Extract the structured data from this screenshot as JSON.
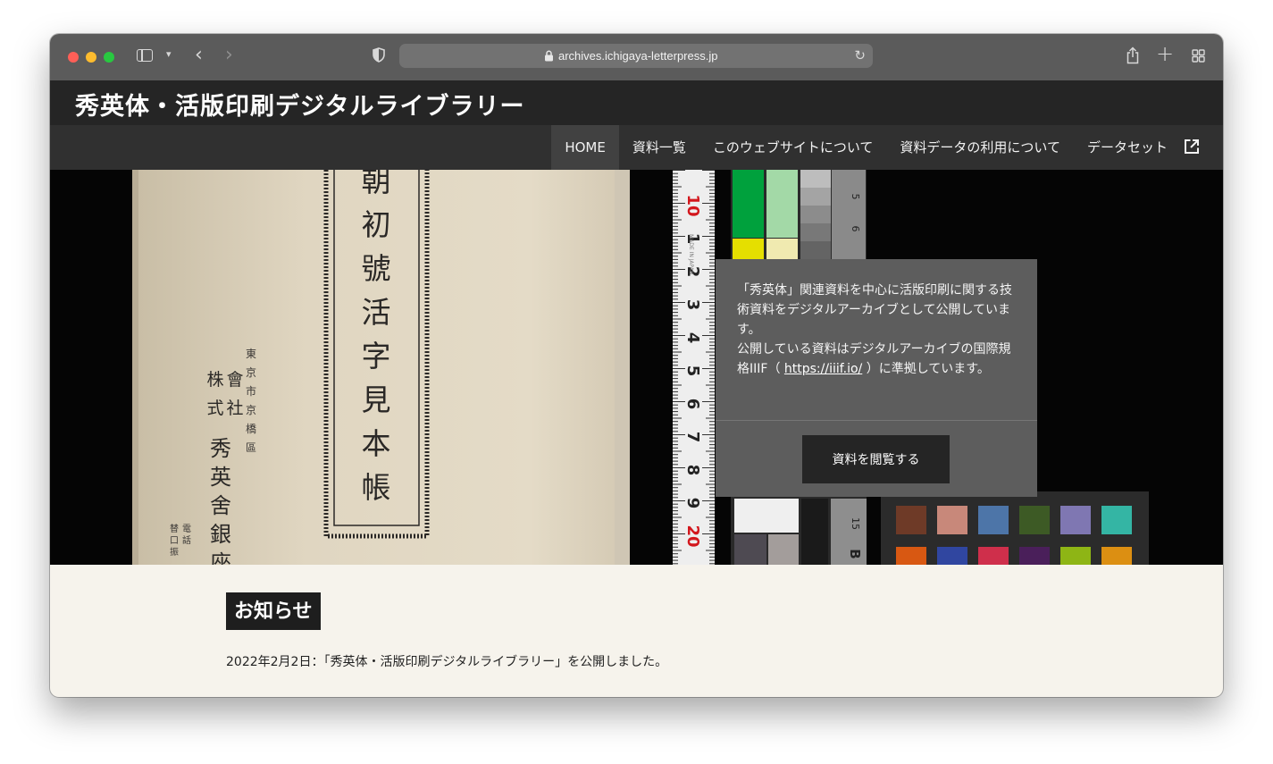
{
  "browser": {
    "url": "archives.ichigaya-letterpress.jp"
  },
  "site": {
    "title": "秀英体・活版印刷デジタルライブラリー"
  },
  "nav": {
    "items": [
      {
        "label": "HOME",
        "active": true
      },
      {
        "label": "資料一覧"
      },
      {
        "label": "このウェブサイトについて"
      },
      {
        "label": "資料データの利用について"
      },
      {
        "label": "データセット",
        "external": true
      }
    ]
  },
  "hero": {
    "book_title_vertical": [
      "朝",
      "初",
      "號",
      "活",
      "字",
      "見",
      "本",
      "帳"
    ],
    "publisher_vertical": [
      "會株",
      "社式",
      "秀",
      "英",
      "舍",
      "銀",
      "座"
    ],
    "address_vertical": [
      "東",
      "京",
      "市",
      "京",
      "橋",
      "區"
    ],
    "phone_vertical": [
      "電",
      "話",
      "振",
      "替",
      "口"
    ],
    "ruler_numbers": [
      "10",
      "1",
      "2",
      "3",
      "4",
      "5",
      "6",
      "7",
      "8",
      "9",
      "20",
      "1"
    ],
    "ruler_brand": "MADE IN JAPAN",
    "gray_scale_numbers": [
      "5",
      "6",
      "15"
    ],
    "gray_scale_letter": "B",
    "color_chart": {
      "swatches_top": [
        "#00a13d",
        "#a3d9a7"
      ],
      "swatches_mid": [
        "#e5df00",
        "#f0eab0"
      ],
      "patches_row1": [
        "#6e3a27",
        "#c8887a",
        "#4d75a8",
        "#3d5a25",
        "#7f77b2",
        "#34b5a4"
      ],
      "patches_row2": [
        "#d85812",
        "#3046a0",
        "#cf2f4b",
        "#4a1f5a",
        "#8eb515",
        "#dc8f12"
      ]
    }
  },
  "info": {
    "paragraph1": "「秀英体」関連資料を中心に活版印刷に関する技術資料をデジタルアーカイブとして公開しています。",
    "paragraph2_before": "公開している資料はデジタルアーカイブの国際規格IIIF（ ",
    "link": "https://iiif.io/",
    "paragraph2_after": " ）に準拠しています。",
    "button_label": "資料を閲覧する"
  },
  "news": {
    "heading": "お知らせ",
    "items": [
      {
        "text": "2022年2月2日：「秀英体・活版印刷デジタルライブラリー」を公開しました。"
      }
    ]
  }
}
